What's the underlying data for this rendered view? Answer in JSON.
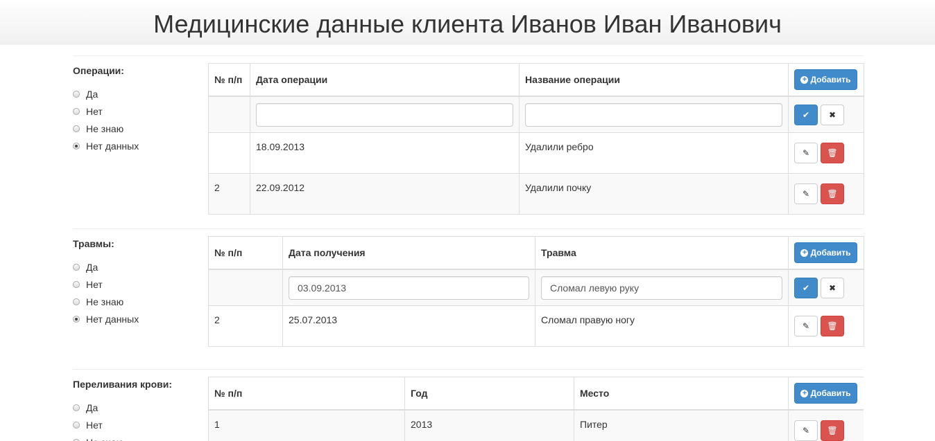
{
  "page": {
    "title": "Медицинские данные клиента Иванов Иван Иванович"
  },
  "common": {
    "radio_options": [
      "Да",
      "Нет",
      "Не знаю",
      "Нет данных"
    ],
    "add_label": "Добавить",
    "icons": {
      "add": "plus-circle-icon",
      "save": "check-icon",
      "cancel": "times-icon",
      "edit": "pencil-icon",
      "delete": "trash-icon"
    },
    "colors": {
      "primary": "#428bca",
      "danger": "#d9534f"
    }
  },
  "operations": {
    "label": "Операции:",
    "selected": "Нет данных",
    "headers": [
      "№ п/п",
      "Дата операции",
      "Название операции"
    ],
    "edit_row": {
      "num": "",
      "date": "",
      "name": ""
    },
    "rows": [
      {
        "num": "",
        "date": "18.09.2013",
        "name": "Удалили ребро"
      },
      {
        "num": "2",
        "date": "22.09.2012",
        "name": "Удалили почку"
      }
    ]
  },
  "injuries": {
    "label": "Травмы:",
    "selected": "Нет данных",
    "headers": [
      "№ п/п",
      "Дата получения",
      "Травма"
    ],
    "edit_row": {
      "num": "",
      "date": "03.09.2013",
      "name": "Сломал левую руку"
    },
    "rows": [
      {
        "num": "2",
        "date": "25.07.2013",
        "name": "Сломал правую ногу"
      }
    ]
  },
  "transfusions": {
    "label": "Переливания крови:",
    "headers": [
      "№ п/п",
      "Год",
      "Место"
    ],
    "rows": [
      {
        "num": "1",
        "year": "2013",
        "place": "Питер"
      }
    ]
  }
}
